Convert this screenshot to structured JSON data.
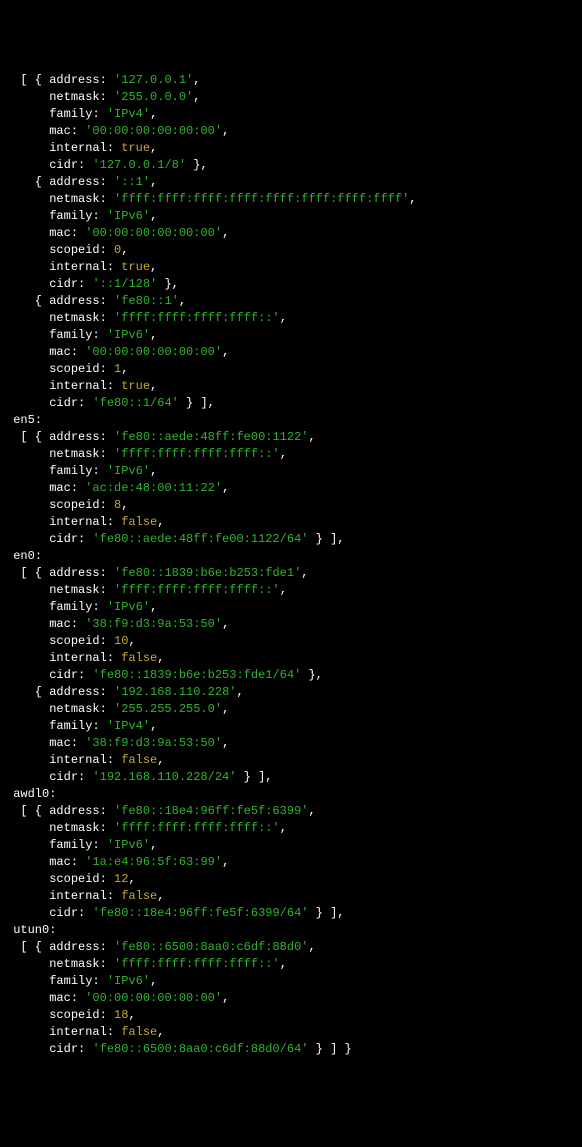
{
  "kw": {
    "address": "address",
    "netmask": "netmask",
    "family": "family",
    "mac": "mac",
    "internal": "internal",
    "cidr": "cidr",
    "scopeid": "scopeid"
  },
  "bool_true": "true",
  "bool_false": "false",
  "interfaces": {
    "lo0": [
      {
        "address": "'127.0.0.1'",
        "netmask": "'255.0.0.0'",
        "family": "'IPv4'",
        "mac": "'00:00:00:00:00:00'",
        "internal": "true",
        "cidr": "'127.0.0.1/8'"
      },
      {
        "address": "'::1'",
        "netmask": "'ffff:ffff:ffff:ffff:ffff:ffff:ffff:ffff'",
        "family": "'IPv6'",
        "mac": "'00:00:00:00:00:00'",
        "scopeid": "0",
        "internal": "true",
        "cidr": "'::1/128'"
      },
      {
        "address": "'fe80::1'",
        "netmask": "'ffff:ffff:ffff:ffff::'",
        "family": "'IPv6'",
        "mac": "'00:00:00:00:00:00'",
        "scopeid": "1",
        "internal": "true",
        "cidr": "'fe80::1/64'"
      }
    ],
    "en5": [
      {
        "address": "'fe80::aede:48ff:fe00:1122'",
        "netmask": "'ffff:ffff:ffff:ffff::'",
        "family": "'IPv6'",
        "mac": "'ac:de:48:00:11:22'",
        "scopeid": "8",
        "internal": "false",
        "cidr": "'fe80::aede:48ff:fe00:1122/64'"
      }
    ],
    "en0": [
      {
        "address": "'fe80::1839:b6e:b253:fde1'",
        "netmask": "'ffff:ffff:ffff:ffff::'",
        "family": "'IPv6'",
        "mac": "'38:f9:d3:9a:53:50'",
        "scopeid": "10",
        "internal": "false",
        "cidr": "'fe80::1839:b6e:b253:fde1/64'"
      },
      {
        "address": "'192.168.110.228'",
        "netmask": "'255.255.255.0'",
        "family": "'IPv4'",
        "mac": "'38:f9:d3:9a:53:50'",
        "internal": "false",
        "cidr": "'192.168.110.228/24'"
      }
    ],
    "awdl0": [
      {
        "address": "'fe80::18e4:96ff:fe5f:6399'",
        "netmask": "'ffff:ffff:ffff:ffff::'",
        "family": "'IPv6'",
        "mac": "'1a:e4:96:5f:63:99'",
        "scopeid": "12",
        "internal": "false",
        "cidr": "'fe80::18e4:96ff:fe5f:6399/64'"
      }
    ],
    "utun0": [
      {
        "address": "'fe80::6500:8aa0:c6df:88d0'",
        "netmask": "'ffff:ffff:ffff:ffff::'",
        "family": "'IPv6'",
        "mac": "'00:00:00:00:00:00'",
        "scopeid": "18",
        "internal": "false",
        "cidr": "'fe80::6500:8aa0:c6df:88d0/64'"
      }
    ]
  },
  "labels": {
    "en5": "en5",
    "en0": "en0",
    "awdl0": "awdl0",
    "utun0": "utun0"
  }
}
